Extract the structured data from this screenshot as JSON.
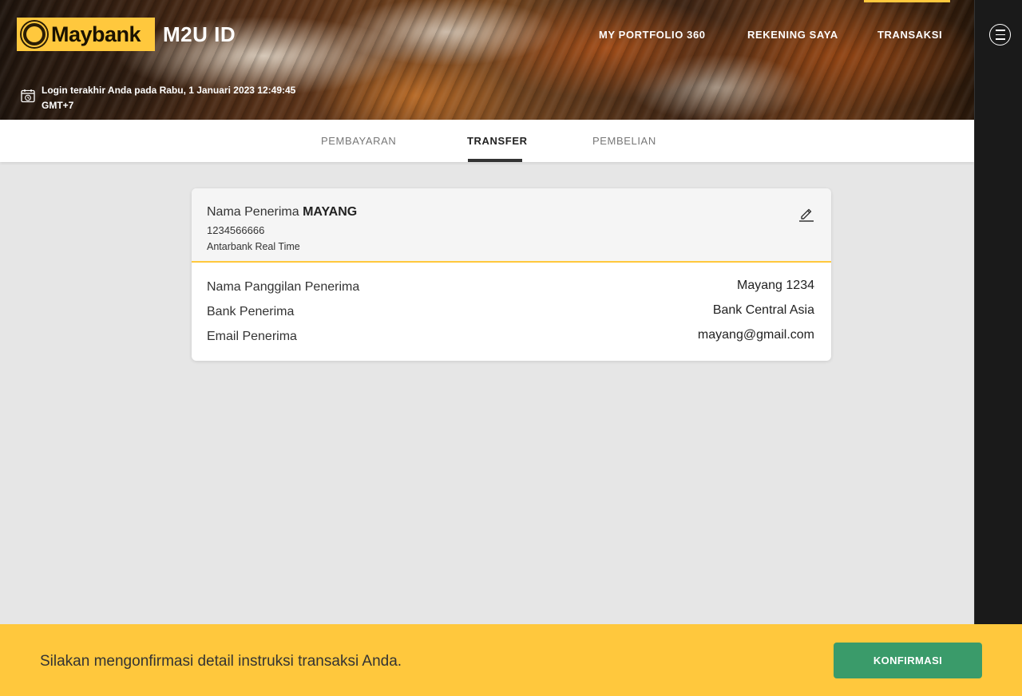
{
  "header": {
    "logo_text": "Maybank",
    "app_name": "M2U ID",
    "nav": [
      "MY PORTFOLIO 360",
      "REKENING SAYA",
      "TRANSAKSI"
    ],
    "last_login": "Login terakhir Anda pada Rabu, 1 Januari 2023 12:49:45 GMT+7"
  },
  "tabs": [
    "PEMBAYARAN",
    "TRANSFER",
    "PEMBELIAN"
  ],
  "card": {
    "recipient_label": "Nama Penerima",
    "recipient_name": "MAYANG",
    "account_number": "1234566666",
    "transfer_type": "Antarbank Real Time",
    "rows": [
      {
        "label": "Nama Panggilan Penerima",
        "value": "Mayang 1234"
      },
      {
        "label": "Bank Penerima",
        "value": "Bank Central Asia"
      },
      {
        "label": "Email Penerima",
        "value": "mayang@gmail.com"
      }
    ]
  },
  "footer": {
    "message": "Silakan mengonfirmasi detail instruksi transaksi Anda.",
    "confirm_label": "KONFIRMASI"
  },
  "colors": {
    "brand_yellow": "#ffc83d",
    "confirm_green": "#3a9b6a"
  },
  "icons": [
    "maybank-logo-icon",
    "calendar-clock-icon",
    "hamburger-menu-icon",
    "edit-pencil-icon"
  ]
}
